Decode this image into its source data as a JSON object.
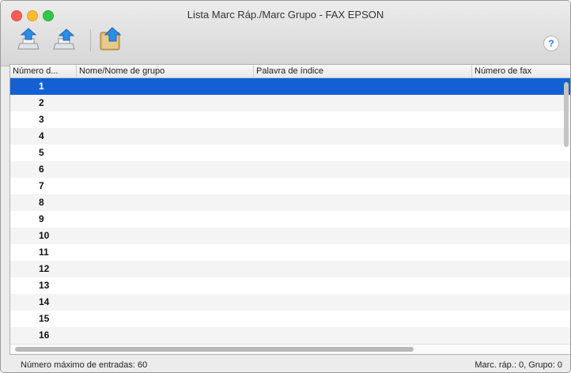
{
  "window": {
    "title": "Lista Marc Ráp./Marc Grupo - FAX EPSON"
  },
  "toolbar": {
    "buttons": [
      {
        "icon": "add-speed-dial-icon"
      },
      {
        "icon": "add-group-dial-icon"
      },
      {
        "icon": "address-book-export-icon"
      }
    ],
    "help_label": "?"
  },
  "table": {
    "columns": [
      "Número d...",
      "Nome/Nome de grupo",
      "Palavra de índice",
      "Número de fax"
    ],
    "rows": [
      "1",
      "2",
      "3",
      "4",
      "5",
      "6",
      "7",
      "8",
      "9",
      "10",
      "11",
      "12",
      "13",
      "14",
      "15",
      "16"
    ],
    "selected_row": "1"
  },
  "status": {
    "left": "Número máximo de entradas: 60",
    "right": "Marc. ráp.: 0, Grupo: 0"
  },
  "colors": {
    "selection": "#1360d4",
    "close": "#fc5e57",
    "minimize": "#fdbc2e",
    "maximize": "#33c748"
  }
}
